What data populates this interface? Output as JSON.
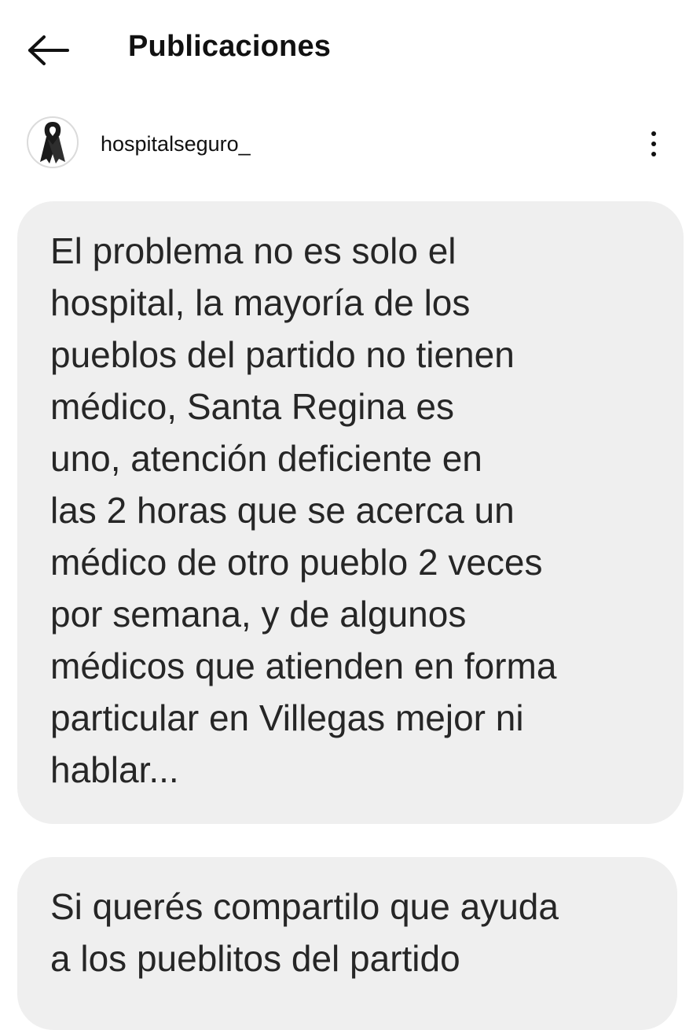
{
  "header": {
    "title": "Publicaciones"
  },
  "post": {
    "username": "hospitalseguro_",
    "avatar_icon": "black-ribbon-icon",
    "more_icon": "more-vertical-icon"
  },
  "bubbles": [
    {
      "lines": [
        "El problema no es solo el",
        "hospital, la mayoría de los",
        "pueblos del partido no tienen",
        "médico, Santa Regina es",
        "uno, atención deficiente en",
        "las 2 horas que se acerca un",
        "médico de otro pueblo 2 veces",
        "por semana, y de algunos",
        "médicos que atienden en forma",
        "particular en Villegas mejor ni",
        "hablar..."
      ]
    },
    {
      "lines": [
        "Si querés compartilo que ayuda",
        "a los pueblitos del partido"
      ]
    }
  ],
  "colors": {
    "bubble_background": "#efefef",
    "text": "#262626",
    "ribbon": "#1a1a1a"
  }
}
